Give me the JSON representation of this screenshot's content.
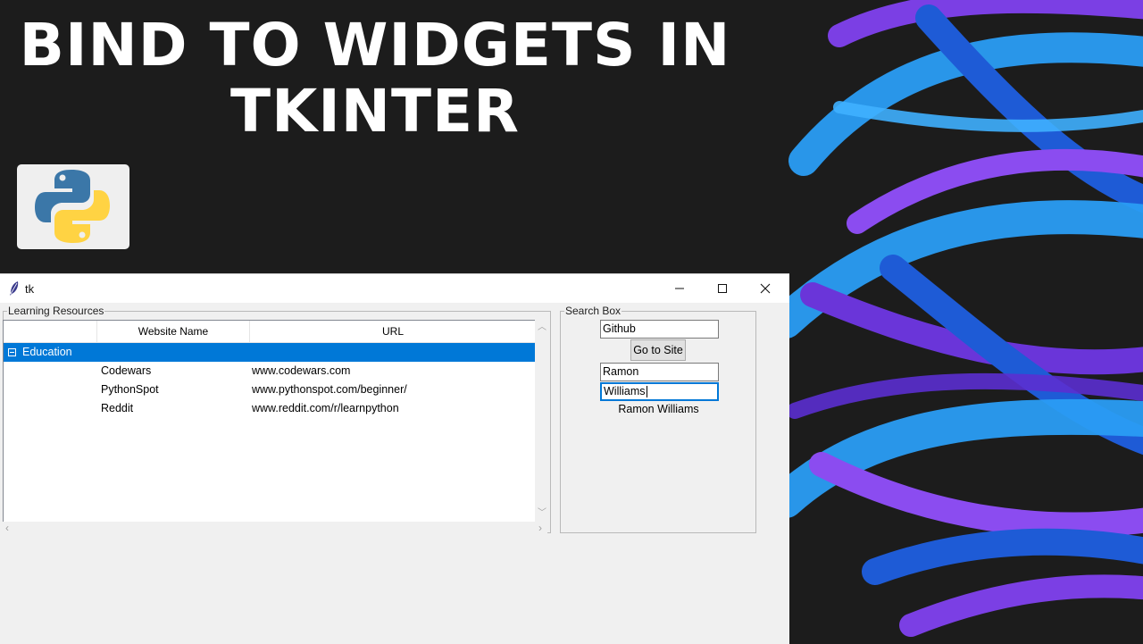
{
  "thumbnail": {
    "title_line1": "BIND TO WIDGETS IN",
    "title_line2": "TKINTER",
    "logo": "python-logo"
  },
  "window": {
    "title": "tk",
    "app_icon": "feather-icon",
    "controls": [
      "minimize-icon",
      "maximize-icon",
      "close-icon"
    ]
  },
  "learning_resources": {
    "legend": "Learning Resources",
    "columns": [
      "Website Name",
      "URL"
    ],
    "parent": {
      "label": "Education",
      "expanded": true,
      "selected": true
    },
    "rows": [
      {
        "name": "Codewars",
        "url": "www.codewars.com"
      },
      {
        "name": "PythonSpot",
        "url": "www.pythonspot.com/beginner/"
      },
      {
        "name": "Reddit",
        "url": "www.reddit.com/r/learnpython"
      }
    ]
  },
  "search_box": {
    "legend": "Search Box",
    "site_entry": "Github",
    "go_button": "Go to Site",
    "first_name": "Ramon",
    "last_name": "Williams",
    "full_name_label": "Ramon Williams"
  },
  "colors": {
    "background": "#1c1c1c",
    "selection": "#0078d7",
    "window_bg": "#f0f0f0",
    "stroke_blue": "#2a9df4",
    "stroke_purple": "#7b3fe4"
  }
}
